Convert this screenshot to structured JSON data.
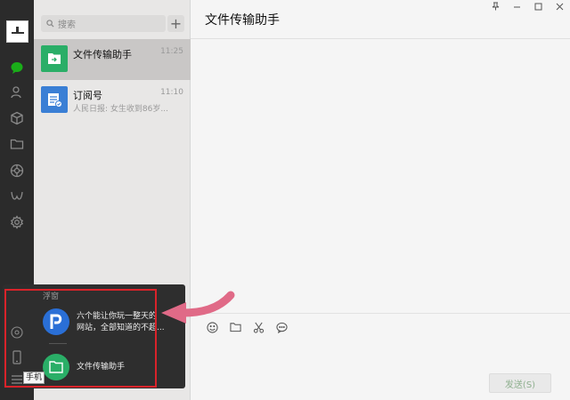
{
  "sidebar": {
    "icons": [
      "chat-icon",
      "contacts-icon",
      "box-icon",
      "folder-icon",
      "moments-icon",
      "miniprogram-icon",
      "settings-icon"
    ]
  },
  "sessions": {
    "search_placeholder": "搜索",
    "add_label": "+",
    "items": [
      {
        "name": "文件传输助手",
        "time": "11:25",
        "preview": ""
      },
      {
        "name": "订阅号",
        "time": "11:10",
        "preview": "人民日报: 女生收到86岁..."
      }
    ]
  },
  "chat": {
    "title": "文件传输助手",
    "send_label": "发送(S)"
  },
  "floating": {
    "header": "浮窗",
    "items": [
      {
        "label_line1": "六个能让你玩一整天的",
        "label_line2": "网站，全部知道的不超..."
      },
      {
        "label_line1": "文件传输助手",
        "label_line2": ""
      }
    ],
    "tooltip": "手机"
  },
  "colors": {
    "accent_green": "#2aae67",
    "highlight_red": "#d9232a",
    "arrow_pink": "#e06a87"
  }
}
